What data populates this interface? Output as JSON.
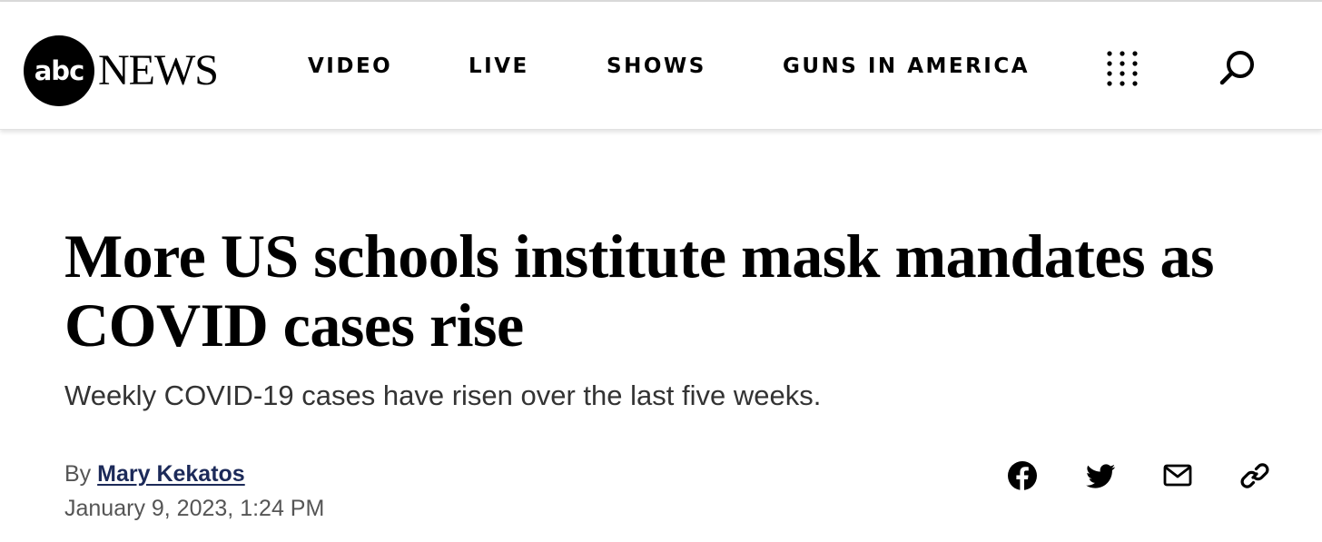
{
  "header": {
    "logo": {
      "mark": "abc",
      "wordmark": "NEWS"
    },
    "nav": [
      {
        "label": "VIDEO"
      },
      {
        "label": "LIVE"
      },
      {
        "label": "SHOWS"
      },
      {
        "label": "GUNS IN AMERICA"
      }
    ],
    "icons": [
      "grid-menu-icon",
      "search-icon"
    ]
  },
  "article": {
    "headline": "More US schools institute mask mandates as COVID cases rise",
    "subheadline": "Weekly COVID-19 cases have risen over the last five weeks.",
    "byline_prefix": "By",
    "author": "Mary Kekatos",
    "timestamp": "January 9, 2023, 1:24 PM"
  },
  "share_icons": [
    "facebook-icon",
    "twitter-icon",
    "email-icon",
    "link-icon"
  ],
  "colors": {
    "author_link": "#1c2a59",
    "text_primary": "#000000",
    "text_secondary": "#555555"
  }
}
